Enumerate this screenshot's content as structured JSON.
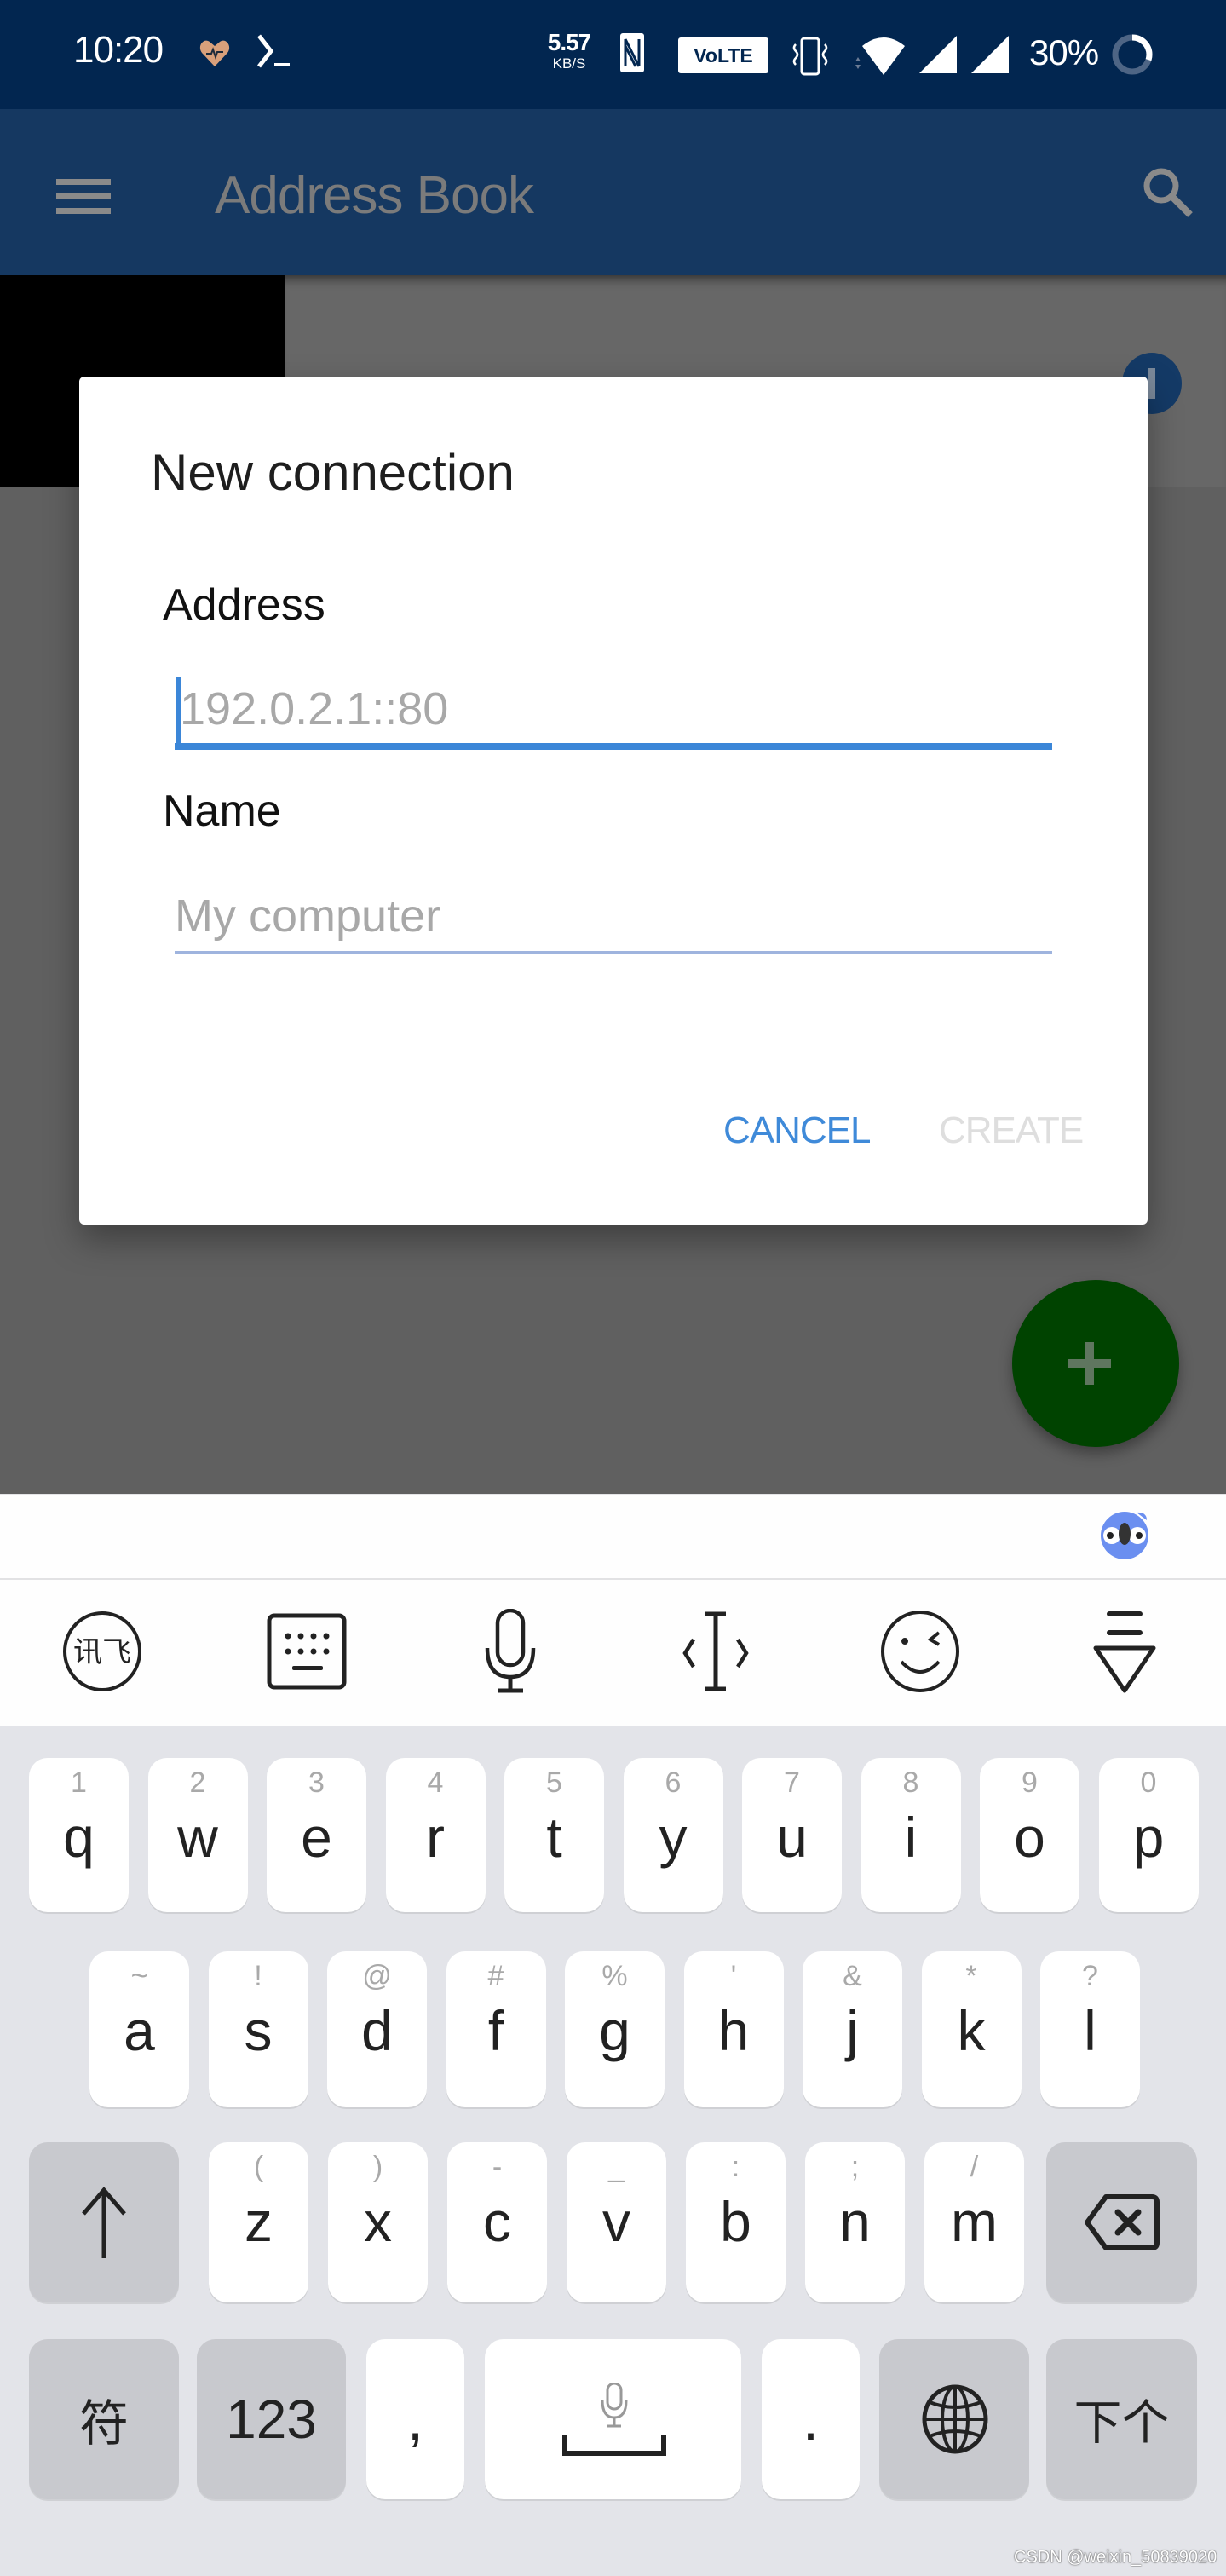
{
  "status_bar": {
    "time": "10:20",
    "net_speed_value": "5.57",
    "net_speed_unit": "KB/S",
    "battery_percent": "30%",
    "battery_level": 0.3,
    "icons": [
      "heart-rate-icon",
      "terminal-icon",
      "nfc-icon",
      "volte-icon",
      "vibrate-icon",
      "wifi-icon",
      "signal-sim1-icon",
      "signal-sim2-icon",
      "battery-ring-icon"
    ],
    "volte_label": "VoLTE"
  },
  "app_bar": {
    "title": "Address Book",
    "menu_icon": "hamburger-menu-icon",
    "search_icon": "search-icon"
  },
  "dialog": {
    "title": "New connection",
    "address_label": "Address",
    "address_value": "",
    "address_placeholder": "192.0.2.1::80",
    "name_label": "Name",
    "name_value": "",
    "name_placeholder": "My computer",
    "cancel_label": "CANCEL",
    "create_label": "CREATE",
    "create_enabled": false
  },
  "fab": {
    "icon": "plus-icon"
  },
  "keyboard": {
    "toolbar": [
      "ifly-logo-icon",
      "keyboard-switch-icon",
      "microphone-icon",
      "cursor-move-icon",
      "emoji-icon",
      "hide-keyboard-icon"
    ],
    "row1": [
      {
        "main": "q",
        "hint": "1"
      },
      {
        "main": "w",
        "hint": "2"
      },
      {
        "main": "e",
        "hint": "3"
      },
      {
        "main": "r",
        "hint": "4"
      },
      {
        "main": "t",
        "hint": "5"
      },
      {
        "main": "y",
        "hint": "6"
      },
      {
        "main": "u",
        "hint": "7"
      },
      {
        "main": "i",
        "hint": "8"
      },
      {
        "main": "o",
        "hint": "9"
      },
      {
        "main": "p",
        "hint": "0"
      }
    ],
    "row2": [
      {
        "main": "a",
        "hint": "~"
      },
      {
        "main": "s",
        "hint": "!"
      },
      {
        "main": "d",
        "hint": "@"
      },
      {
        "main": "f",
        "hint": "#"
      },
      {
        "main": "g",
        "hint": "%"
      },
      {
        "main": "h",
        "hint": "'"
      },
      {
        "main": "j",
        "hint": "&"
      },
      {
        "main": "k",
        "hint": "*"
      },
      {
        "main": "l",
        "hint": "?"
      }
    ],
    "row3": [
      {
        "main": "z",
        "hint": "("
      },
      {
        "main": "x",
        "hint": ")"
      },
      {
        "main": "c",
        "hint": "-"
      },
      {
        "main": "v",
        "hint": "_"
      },
      {
        "main": "b",
        "hint": ":"
      },
      {
        "main": "n",
        "hint": ";"
      },
      {
        "main": "m",
        "hint": "/"
      }
    ],
    "symbol_key": "符",
    "number_key": "123",
    "comma_key": ",",
    "period_key": ".",
    "next_key": "下个"
  },
  "watermark": "CSDN @weixin_50839020"
}
